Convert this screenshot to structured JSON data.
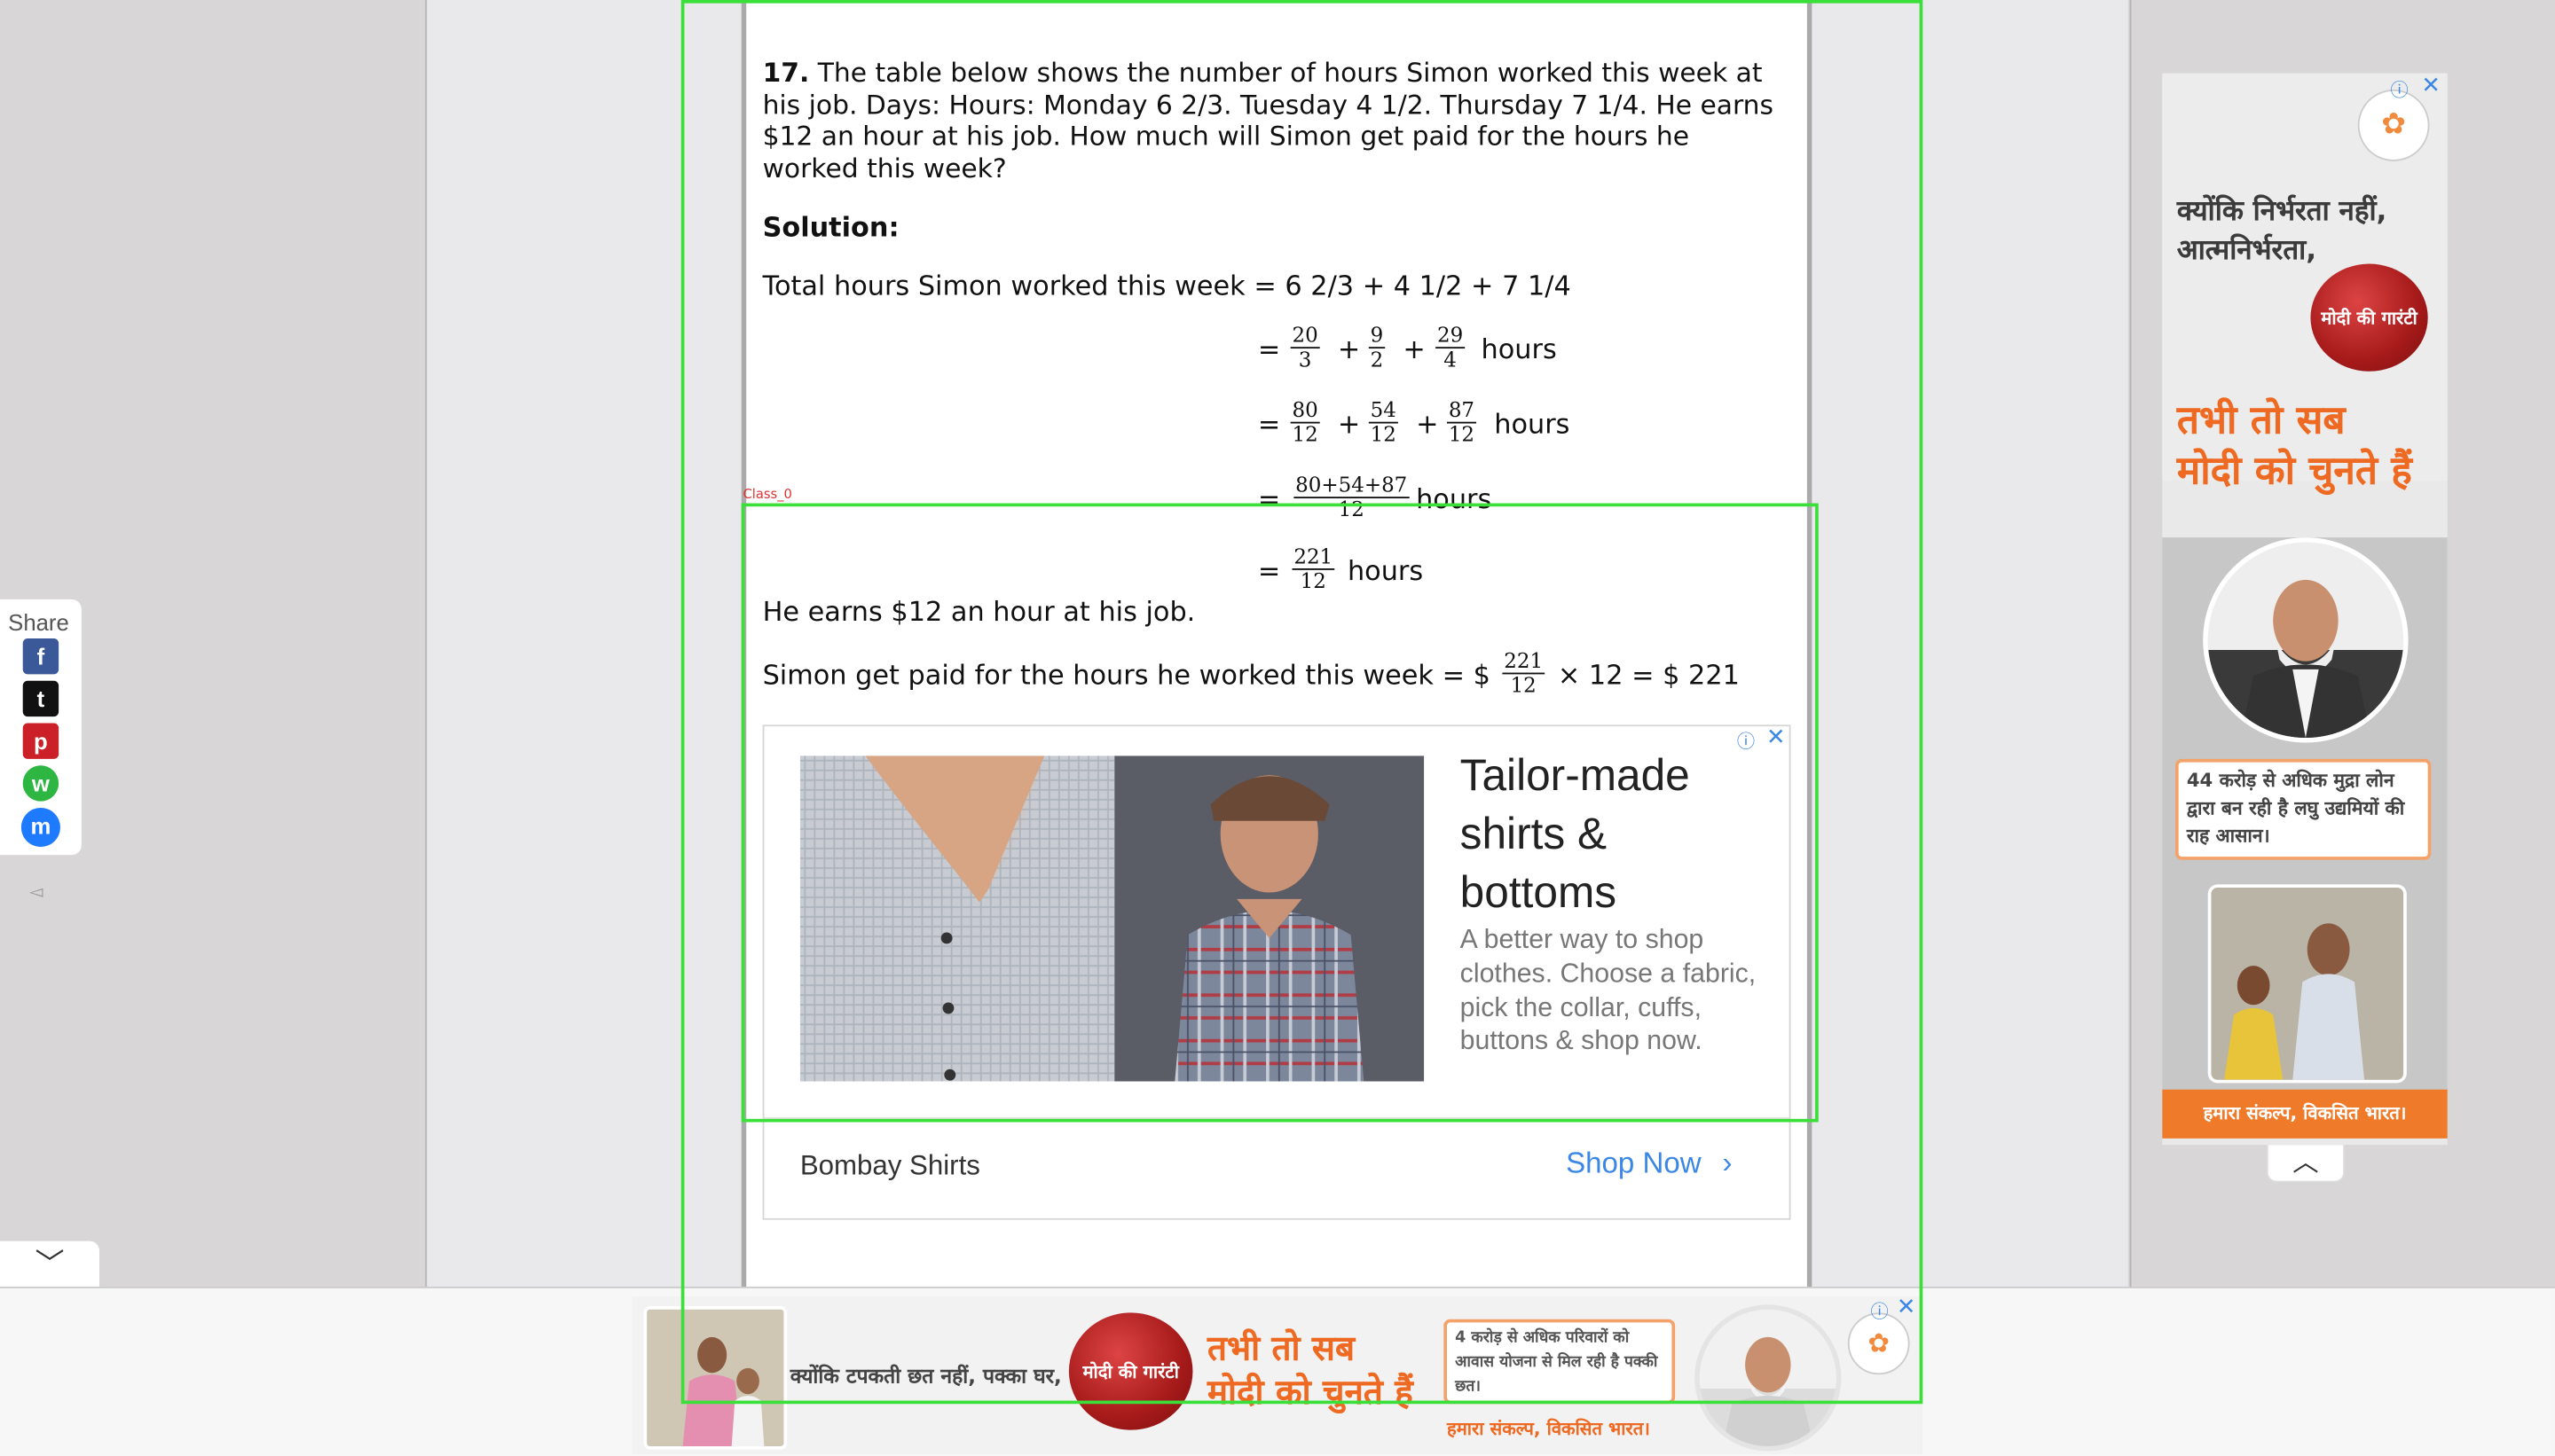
{
  "question": {
    "number": "17.",
    "text": "The table below shows the number of hours Simon worked this week at his job. Days: Hours: Monday 6 2/3. Tuesday 4 1/2. Thursday 7 1/4. He earns $12 an hour at his job. How much will Simon get paid for the hours he worked this week?"
  },
  "solution": {
    "heading": "Solution:",
    "line1": "Total hours Simon worked this week = 6 2/3 + 4 1/2 + 7 1/4",
    "eq": "=",
    "plus": "+",
    "unit": "hours",
    "row1": [
      {
        "n": "20",
        "d": "3"
      },
      {
        "n": "9",
        "d": "2"
      },
      {
        "n": "29",
        "d": "4"
      }
    ],
    "row2": [
      {
        "n": "80",
        "d": "12"
      },
      {
        "n": "54",
        "d": "12"
      },
      {
        "n": "87",
        "d": "12"
      }
    ],
    "row3": {
      "n": "80+54+87",
      "d": "12"
    },
    "row4": {
      "n": "221",
      "d": "12"
    },
    "earn_line": "He earns $12 an hour at his job.",
    "paid_prefix": "Simon get paid for the hours he worked this week = $",
    "paid_frac": {
      "n": "221",
      "d": "12"
    },
    "paid_suffix": "× 12 = $ 221"
  },
  "annotation": {
    "label": "Class_0"
  },
  "inline_ad": {
    "title": "Tailor-made shirts & bottoms",
    "description": "A better way to shop clothes. Choose a fabric, pick the collar, cuffs, buttons & shop now.",
    "brand": "Bombay Shirts",
    "cta": "Shop Now",
    "choices_icon": "ⓘ",
    "close_icon": "✕"
  },
  "right_ad": {
    "headline1": "क्योंकि निर्भरता नहीं,",
    "headline2": "आत्मनिर्भरता,",
    "seal_text": "मोदी की गारंटी",
    "orange1": "तभी तो सब",
    "orange2": "मोदी को चुनते हैं",
    "box_text": "44 करोड़ से अधिक मुद्रा लोन द्वारा बन रही है लघु उद्यमियों की राह आसान।",
    "band": "हमारा संकल्प, विकसित भारत।"
  },
  "bottom_ad": {
    "text1": "क्योंकि टपकती छत नहीं, पक्का घर,",
    "seal_text": "मोदी की गारंटी",
    "orange1": "तभी तो सब",
    "orange2": "मोदी को चुनते हैं",
    "box_text": "4 करोड़ से अधिक परिवारों को आवास योजना से मिल रही है पक्की छत।",
    "band": "हमारा संकल्प, विकसित भारत।"
  },
  "share": {
    "label": "Share",
    "buttons": [
      {
        "name": "facebook",
        "glyph": "f",
        "color": "#3b5998"
      },
      {
        "name": "twitter",
        "glyph": "t",
        "color": "#111111"
      },
      {
        "name": "pinterest",
        "glyph": "p",
        "color": "#cb2027"
      },
      {
        "name": "whatsapp",
        "glyph": "w",
        "color": "#2db742"
      },
      {
        "name": "messenger",
        "glyph": "m",
        "color": "#1e7bff"
      }
    ]
  }
}
